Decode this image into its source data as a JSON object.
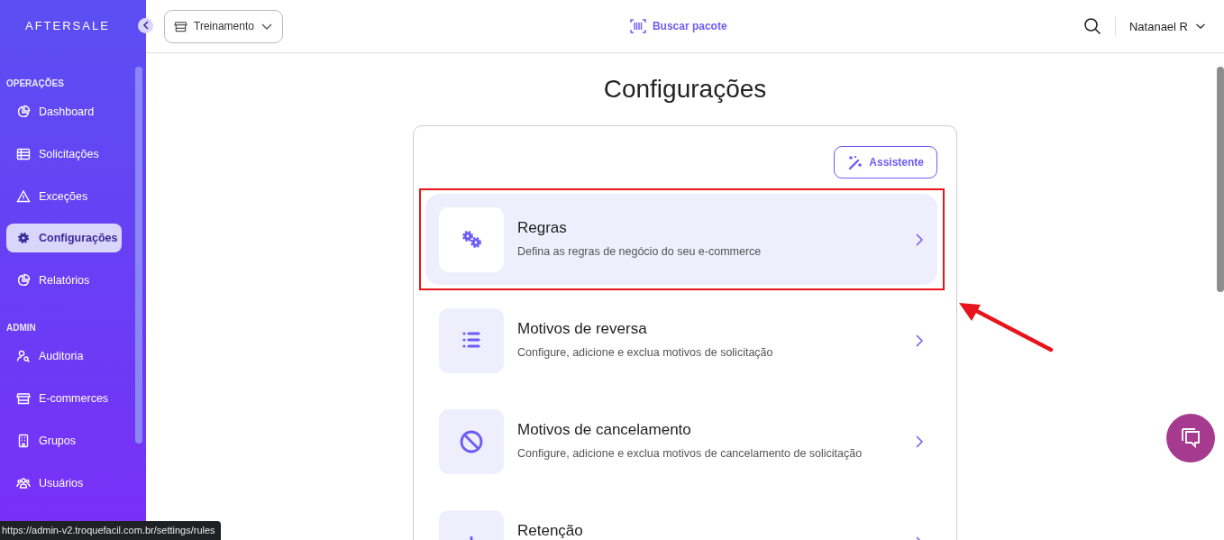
{
  "sidebar": {
    "logo": "AFTERSALE",
    "sections": [
      {
        "title": "OPERAÇÕES",
        "items": [
          {
            "label": "Dashboard",
            "kind": "pie",
            "selected": false
          },
          {
            "label": "Solicitações",
            "kind": "table",
            "selected": false
          },
          {
            "label": "Exceções",
            "kind": "warning",
            "selected": false
          },
          {
            "label": "Configurações",
            "kind": "gear",
            "selected": true
          },
          {
            "label": "Relatórios",
            "kind": "pie",
            "selected": false
          }
        ]
      },
      {
        "title": "ADMIN",
        "items": [
          {
            "label": "Auditoria",
            "kind": "usersearch",
            "selected": false
          },
          {
            "label": "E-commerces",
            "kind": "store",
            "selected": false
          },
          {
            "label": "Grupos",
            "kind": "building",
            "selected": false
          },
          {
            "label": "Usuários",
            "kind": "users",
            "selected": false
          }
        ]
      }
    ]
  },
  "header": {
    "store_select": "Treinamento",
    "search_package": "Buscar pacote",
    "user": "Natanael R"
  },
  "page": {
    "title": "Configurações",
    "assistant_button": "Assistente",
    "items": [
      {
        "title": "Regras",
        "description": "Defina as regras de negócio do seu e-commerce",
        "kind": "gears",
        "selected": true,
        "annotated": true
      },
      {
        "title": "Motivos de reversa",
        "description": "Configure, adicione e exclua motivos de solicitação",
        "kind": "list",
        "selected": false,
        "annotated": false
      },
      {
        "title": "Motivos de cancelamento",
        "description": "Configure, adicione e exclua motivos de cancelamento de solicitação",
        "kind": "ban",
        "selected": false,
        "annotated": false
      },
      {
        "title": "Retenção",
        "kind": "plus",
        "selected": false,
        "annotated": false
      }
    ]
  },
  "status_url": "https://admin-v2.troquefacil.com.br/settings/rules"
}
